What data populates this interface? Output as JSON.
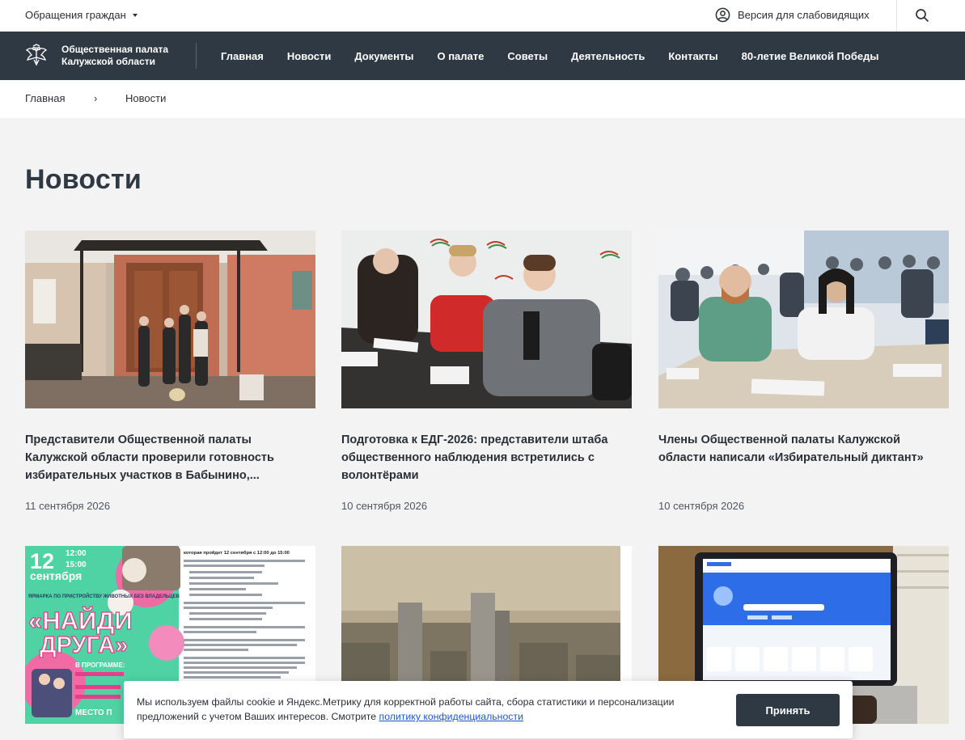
{
  "topbar": {
    "appeals_label": "Обращения граждан",
    "accessibility_label": "Версия для слабовидящих"
  },
  "header": {
    "logo_line1": "Общественная палата",
    "logo_line2": "Калужской области",
    "nav": [
      {
        "label": "Главная"
      },
      {
        "label": "Новости"
      },
      {
        "label": "Документы"
      },
      {
        "label": "О палате"
      },
      {
        "label": "Советы"
      },
      {
        "label": "Деятельность"
      },
      {
        "label": "Контакты"
      },
      {
        "label": "80-летие Великой Победы"
      }
    ]
  },
  "breadcrumb": {
    "home": "Главная",
    "separator": "›",
    "current": "Новости"
  },
  "page": {
    "title": "Новости"
  },
  "news": [
    {
      "title": "Представители Общественной палаты Калужской области проверили готовность избирательных участков в Бабынино,...",
      "date": "11 сентября 2026"
    },
    {
      "title": "Подготовка к ЕДГ-2026: представители штаба общественного наблюдения встретились с волонтёрами",
      "date": "10 сентября 2026"
    },
    {
      "title": "Члены Общественной палаты Калужской области написали «Избирательный диктант»",
      "date": "10 сентября 2026"
    },
    {
      "poster": {
        "day": "12",
        "month": "сентября",
        "time_from": "12:00",
        "time_to": "15:00",
        "fair": "ЯРМАРКА ПО ПРИСТРОЙСТВУ ЖИВОТНЫХ БЕЗ ВЛАДЕЛЬЦЕВ",
        "headline_1": "«НАЙДИ",
        "headline_2": "ДРУГА»",
        "program": "В ПРОГРАММЕ:",
        "place": "МЕСТО П",
        "right_heading": "которая пройдет 12 сентября с 12:00 до 15:00"
      }
    },
    {},
    {}
  ],
  "cookie": {
    "text": "Мы используем файлы cookie и Яндекс.Метрику для корректной работы сайта, сбора статистики и персонализации предложений с учетом Ваших интересов. Смотрите",
    "link": "политику конфиденциальности",
    "button": "Принять"
  }
}
